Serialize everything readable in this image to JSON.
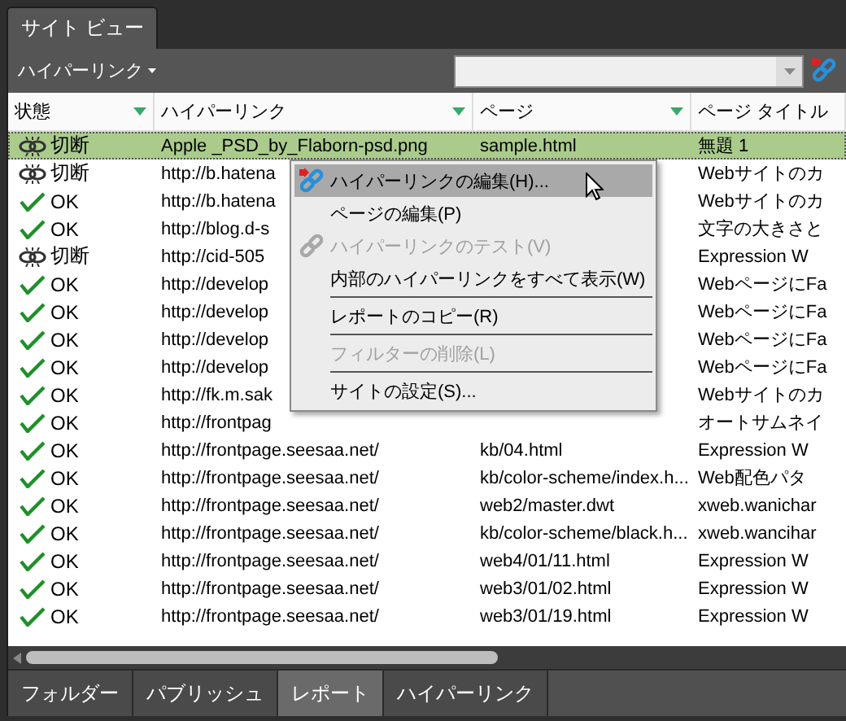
{
  "window_tab": {
    "label": "サイト ビュー",
    "selected": true
  },
  "toolbar": {
    "view_menu": "ハイパーリンク"
  },
  "table": {
    "columns": [
      {
        "label": "状態",
        "filter_arrow": true
      },
      {
        "label": "ハイパーリンク",
        "filter_arrow": true
      },
      {
        "label": "ページ",
        "filter_arrow": true
      },
      {
        "label": "ページ タイトル",
        "filter_arrow": false
      }
    ],
    "rows": [
      {
        "kind": "broken",
        "status": "切断",
        "hyperlink": "Apple _PSD_by_Flaborn-psd.png",
        "page": "sample.html",
        "title": "無題 1",
        "selected": true
      },
      {
        "kind": "broken",
        "status": "切断",
        "hyperlink": "http://b.hatena",
        "title": "Webサイトのカ",
        "selected": false
      },
      {
        "kind": "ok",
        "status": "OK",
        "hyperlink": "http://b.hatena",
        "title": "Webサイトのカ",
        "selected": false
      },
      {
        "kind": "ok",
        "status": "OK",
        "hyperlink": "http://blog.d-s",
        "title": "文字の大きさと",
        "selected": false
      },
      {
        "kind": "broken",
        "status": "切断",
        "hyperlink": "http://cid-505",
        "title": "Expression W",
        "selected": false
      },
      {
        "kind": "ok",
        "status": "OK",
        "hyperlink": "http://develop",
        "title": "WebページにFa",
        "selected": false
      },
      {
        "kind": "ok",
        "status": "OK",
        "hyperlink": "http://develop",
        "title": "WebページにFa",
        "selected": false
      },
      {
        "kind": "ok",
        "status": "OK",
        "hyperlink": "http://develop",
        "title": "WebページにFa",
        "selected": false
      },
      {
        "kind": "ok",
        "status": "OK",
        "hyperlink": "http://develop",
        "title": "WebページにFa",
        "selected": false
      },
      {
        "kind": "ok",
        "status": "OK",
        "hyperlink": "http://fk.m.sak",
        "title": "Webサイトのカ",
        "selected": false
      },
      {
        "kind": "ok",
        "status": "OK",
        "hyperlink": "http://frontpag",
        "title": "オートサムネイ",
        "selected": false
      },
      {
        "kind": "ok",
        "status": "OK",
        "hyperlink": "http://frontpage.seesaa.net/",
        "page": "kb/04.html",
        "title": "Expression W",
        "selected": false
      },
      {
        "kind": "ok",
        "status": "OK",
        "hyperlink": "http://frontpage.seesaa.net/",
        "page": "kb/color-scheme/index.h...",
        "title": "Web配色パタ",
        "selected": false
      },
      {
        "kind": "ok",
        "status": "OK",
        "hyperlink": "http://frontpage.seesaa.net/",
        "page": "web2/master.dwt",
        "title": "xweb.wanichar",
        "selected": false
      },
      {
        "kind": "ok",
        "status": "OK",
        "hyperlink": "http://frontpage.seesaa.net/",
        "page": "kb/color-scheme/black.h...",
        "title": "xweb.wancihar",
        "selected": false
      },
      {
        "kind": "ok",
        "status": "OK",
        "hyperlink": "http://frontpage.seesaa.net/",
        "page": "web4/01/11.html",
        "title": "Expression W",
        "selected": false
      },
      {
        "kind": "ok",
        "status": "OK",
        "hyperlink": "http://frontpage.seesaa.net/",
        "page": "web3/01/02.html",
        "title": "Expression W",
        "selected": false
      },
      {
        "kind": "ok",
        "status": "OK",
        "hyperlink": "http://frontpage.seesaa.net/",
        "page": "web3/01/19.html",
        "title": "Expression W",
        "selected": false
      }
    ]
  },
  "context_menu": {
    "items": [
      {
        "kind": "item",
        "label": "ハイパーリンクの編集(H)...",
        "has_icon": true,
        "selected": true,
        "disabled": false
      },
      {
        "kind": "item",
        "label": "ページの編集(P)",
        "has_icon": false,
        "selected": false,
        "disabled": false
      },
      {
        "kind": "item",
        "label": "ハイパーリンクのテスト(V)",
        "has_icon": true,
        "selected": false,
        "disabled": true
      },
      {
        "kind": "item",
        "label": "内部のハイパーリンクをすべて表示(W)",
        "has_icon": false,
        "selected": false,
        "disabled": false
      },
      {
        "kind": "separator"
      },
      {
        "kind": "item",
        "label": "レポートのコピー(R)",
        "has_icon": false,
        "selected": false,
        "disabled": false
      },
      {
        "kind": "separator"
      },
      {
        "kind": "item",
        "label": "フィルターの削除(L)",
        "has_icon": false,
        "selected": false,
        "disabled": true
      },
      {
        "kind": "separator"
      },
      {
        "kind": "item",
        "label": "サイトの設定(S)...",
        "has_icon": false,
        "selected": false,
        "disabled": false
      }
    ]
  },
  "bottom_tabs": [
    {
      "label": "フォルダー",
      "selected": false
    },
    {
      "label": "パブリッシュ",
      "selected": false
    },
    {
      "label": "レポート",
      "selected": true
    },
    {
      "label": "ハイパーリンク",
      "selected": false
    }
  ]
}
